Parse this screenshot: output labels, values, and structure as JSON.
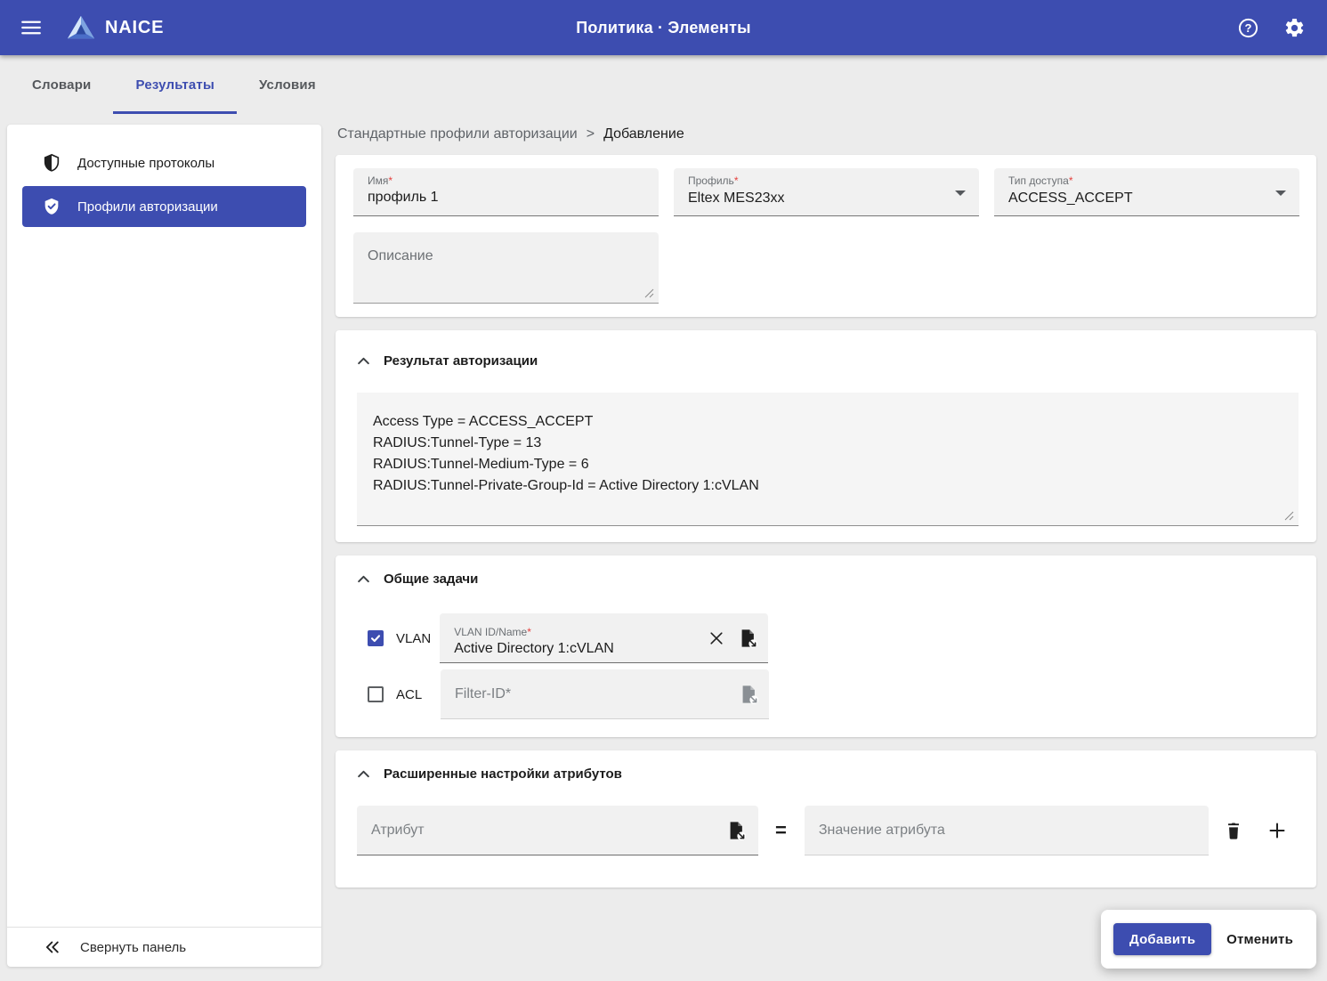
{
  "colors": {
    "primary": "#3d4db0",
    "asterisk": "#e5413e",
    "page_bg": "#ececec"
  },
  "app_bar": {
    "brand": "NAICE",
    "title": "Политика · Элементы"
  },
  "tabs": [
    {
      "label": "Словари",
      "active": false
    },
    {
      "label": "Результаты",
      "active": true
    },
    {
      "label": "Условия",
      "active": false
    }
  ],
  "sidebar": {
    "items": [
      {
        "label": "Доступные протоколы",
        "selected": false
      },
      {
        "label": "Профили авторизации",
        "selected": true
      }
    ],
    "collapse_label": "Свернуть панель"
  },
  "breadcrumb": {
    "parent": "Стандартные профили авторизации",
    "separator": ">",
    "current": "Добавление"
  },
  "profile_form": {
    "name": {
      "label": "Имя",
      "required_mark": "*",
      "value": "профиль 1"
    },
    "profile": {
      "label": "Профиль",
      "required_mark": "*",
      "value": "Eltex MES23xx"
    },
    "access_type": {
      "label": "Тип доступа",
      "required_mark": "*",
      "value": "ACCESS_ACCEPT"
    },
    "description": {
      "placeholder": "Описание",
      "value": ""
    }
  },
  "authorization_result": {
    "title": "Результат авторизации",
    "value": "Access Type = ACCESS_ACCEPT\nRADIUS:Tunnel-Type = 13\nRADIUS:Tunnel-Medium-Type = 6\nRADIUS:Tunnel-Private-Group-Id = Active Directory 1:cVLAN"
  },
  "common_tasks": {
    "title": "Общие задачи",
    "vlan": {
      "checked": true,
      "checkbox_label": "VLAN",
      "field_label": "VLAN ID/Name",
      "required_mark": "*",
      "value": "Active Directory 1:cVLAN"
    },
    "acl": {
      "checked": false,
      "checkbox_label": "ACL",
      "placeholder": "Filter-ID*",
      "value": ""
    }
  },
  "advanced_attributes": {
    "title": "Расширенные настройки атрибутов",
    "attribute_placeholder": "Атрибут",
    "equals_sign": "=",
    "value_placeholder": "Значение атрибута"
  },
  "actions": {
    "submit_label": "Добавить",
    "cancel_label": "Отменить"
  }
}
